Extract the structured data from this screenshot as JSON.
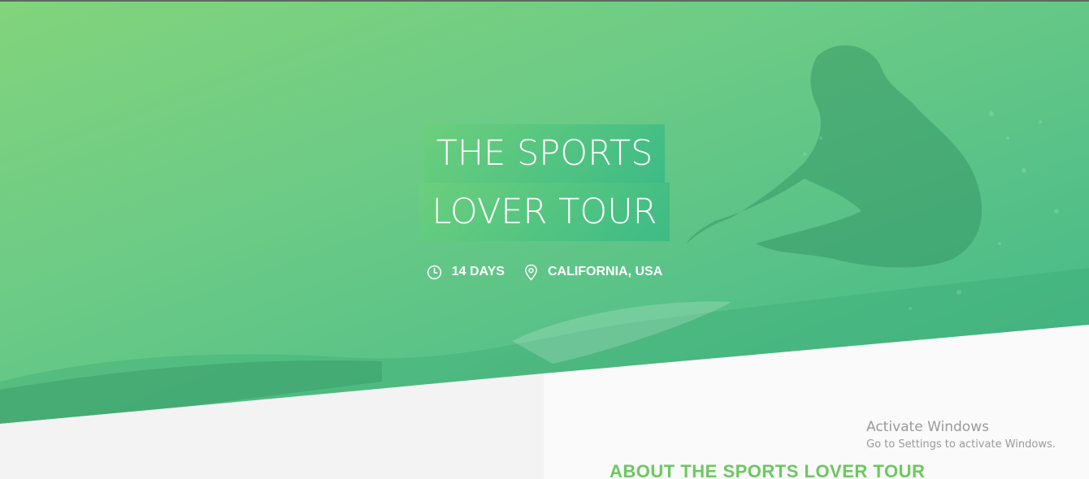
{
  "hero": {
    "title_line_1": "THE SPORTS",
    "title_line_2": "LOVER TOUR",
    "duration": "14 DAYS",
    "location": "CALIFORNIA, USA",
    "duration_icon": "clock-icon",
    "location_icon": "map-pin-icon",
    "overlay_color_start": "#82d47c",
    "overlay_color_end": "#3fb488"
  },
  "about": {
    "heading": "ABOUT THE SPORTS LOVER TOUR",
    "heading_color": "#6cc860"
  },
  "watermark": {
    "title": "Activate Windows",
    "subtitle": "Go to Settings to activate Windows."
  }
}
